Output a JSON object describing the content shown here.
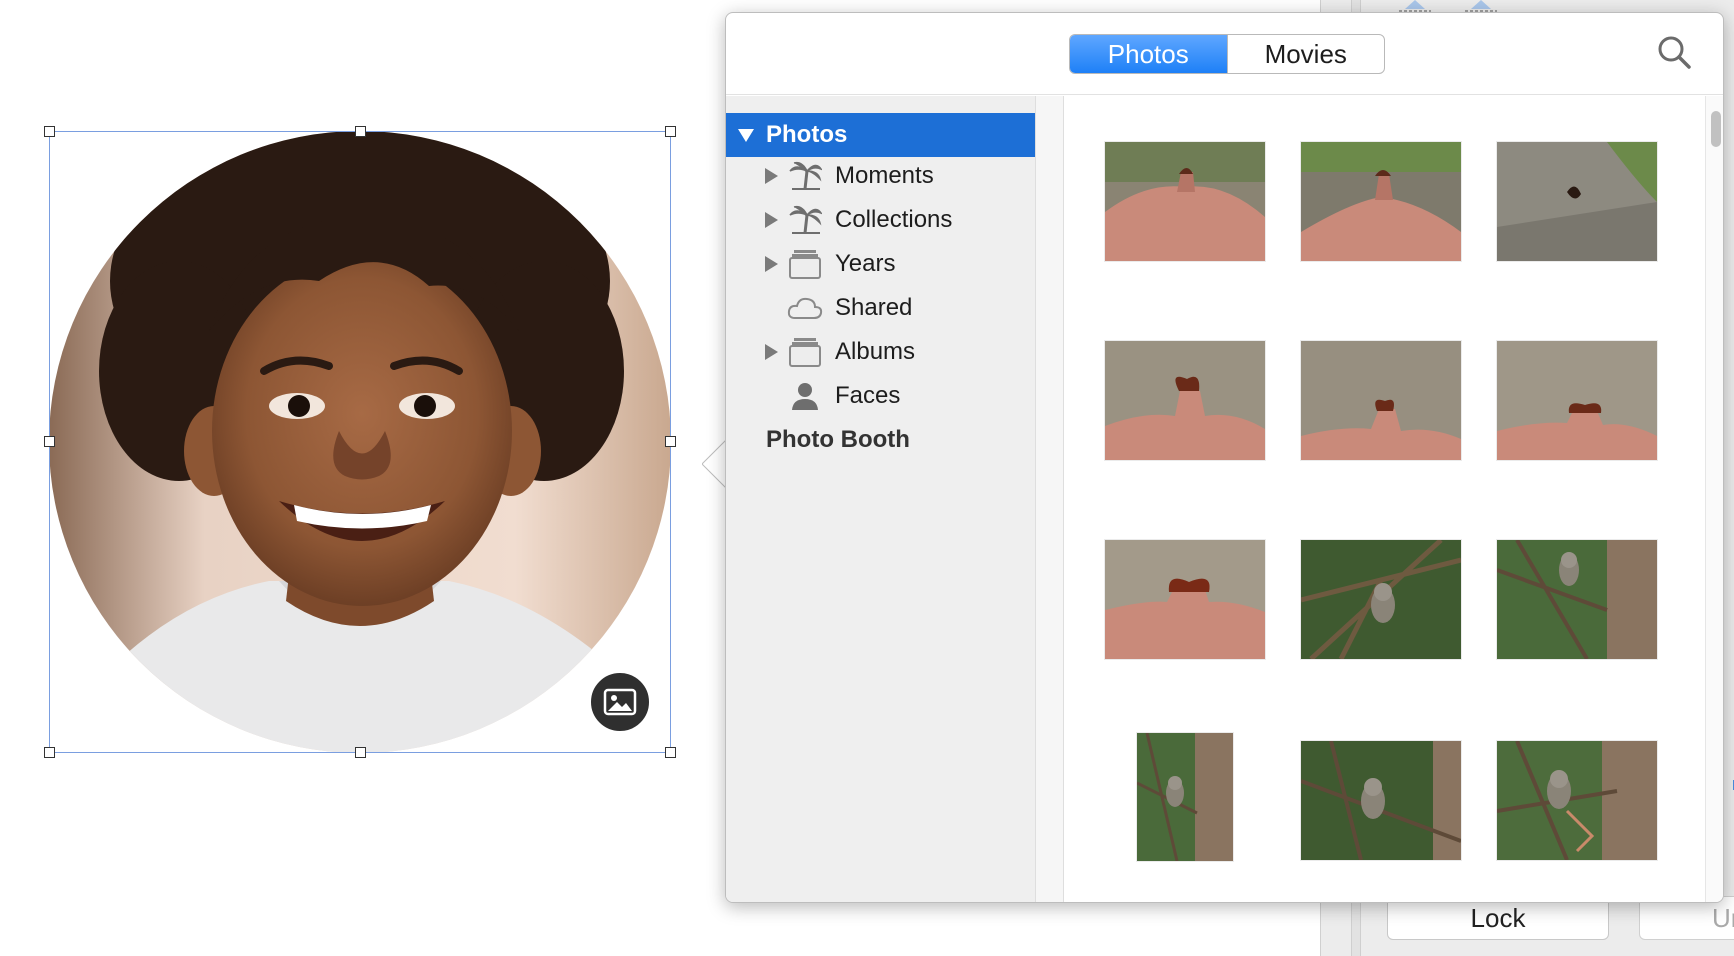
{
  "popover": {
    "segments": [
      {
        "label": "Photos",
        "active": true
      },
      {
        "label": "Movies",
        "active": false
      }
    ],
    "search_icon": "magnifying-glass-icon"
  },
  "sidebar": {
    "header": {
      "label": "Photos",
      "expanded": true,
      "selected": true
    },
    "items": [
      {
        "label": "Moments",
        "icon": "palm-tree-icon",
        "expandable": true
      },
      {
        "label": "Collections",
        "icon": "palm-tree-icon",
        "expandable": true
      },
      {
        "label": "Years",
        "icon": "stack-folder-icon",
        "expandable": true
      },
      {
        "label": "Shared",
        "icon": "cloud-icon",
        "expandable": false
      },
      {
        "label": "Albums",
        "icon": "stack-folder-icon",
        "expandable": true
      },
      {
        "label": "Faces",
        "icon": "person-icon",
        "expandable": false
      }
    ],
    "photo_booth": {
      "label": "Photo Booth"
    }
  },
  "thumbnails": [
    {
      "subject": "butterfly on stone",
      "orientation": "landscape"
    },
    {
      "subject": "butterfly on stone",
      "orientation": "landscape"
    },
    {
      "subject": "butterfly on rock",
      "orientation": "landscape"
    },
    {
      "subject": "butterfly on stone",
      "orientation": "landscape"
    },
    {
      "subject": "butterfly on stone",
      "orientation": "landscape"
    },
    {
      "subject": "butterfly on stone",
      "orientation": "landscape"
    },
    {
      "subject": "butterfly on stone",
      "orientation": "landscape"
    },
    {
      "subject": "owl in tree",
      "orientation": "landscape"
    },
    {
      "subject": "owl in tree",
      "orientation": "landscape"
    },
    {
      "subject": "owl in tree",
      "orientation": "portrait"
    },
    {
      "subject": "owl in tree",
      "orientation": "landscape"
    },
    {
      "subject": "owl in tree",
      "orientation": "landscape"
    }
  ],
  "canvas": {
    "image": "child-portrait",
    "media_button_icon": "image-icon"
  },
  "inspector": {
    "lock_label": "Lock",
    "unlock_label": "Un"
  },
  "colors": {
    "accent": "#1d6fd6",
    "segment_active": "#1e80f7",
    "selection_border": "#7a9ee0"
  }
}
